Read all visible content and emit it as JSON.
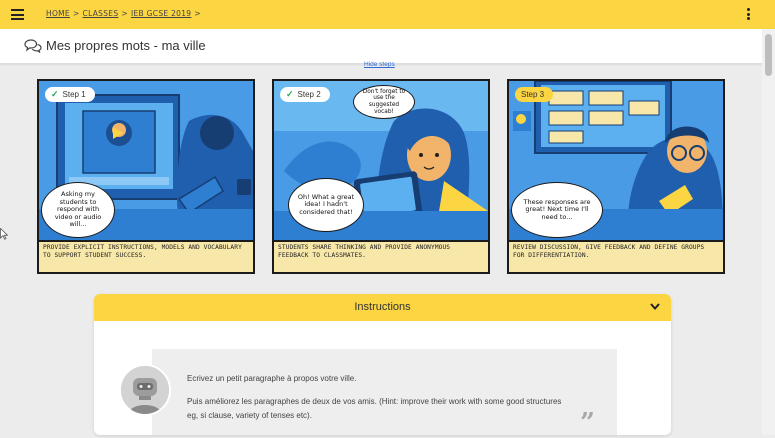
{
  "breadcrumb": {
    "items": [
      "HOME",
      "CLASSES",
      "IEB GCSE 2019"
    ],
    "separator": ">"
  },
  "page": {
    "title": "Mes propres mots - ma ville",
    "hide_steps": "Hide steps"
  },
  "steps": [
    {
      "badge": "Step 1",
      "completed": true,
      "bubble": "Asking my students to respond with video or audio will...",
      "caption": "Provide explicit instructions, models and vocabulary to support student success."
    },
    {
      "badge": "Step 2",
      "completed": true,
      "bubble_top": "Don't forget to use the suggested vocab!",
      "bubble": "Oh! What a great idea! I hadn't considered that!",
      "caption": "Students share thinking and provide anonymous feedback to classmates."
    },
    {
      "badge": "Step 3",
      "completed": false,
      "bubble": "These responses are great! Next time I'll need to...",
      "caption": "Review discussion, give feedback and define groups for differentiation."
    }
  ],
  "instructions": {
    "title": "Instructions",
    "lines": [
      "Ecrivez un petit paragraphe à propos votre ville.",
      "Puis améliorez les paragraphes de deux de vos amis.  (Hint: improve their work with some good structures",
      "eg, si clause, variety of tenses etc)."
    ],
    "quote_glyph": "”"
  },
  "colors": {
    "brand_yellow": "#fbd542",
    "panel_blue": "#3a8fe0",
    "caption_bg": "#f7e7a8",
    "link_blue": "#2f6bd8"
  },
  "icons": {
    "menu": "hamburger-icon",
    "more": "more-vertical-icon",
    "title": "chat-bubbles-icon",
    "expand": "chevron-down-icon",
    "check": "check-icon"
  }
}
